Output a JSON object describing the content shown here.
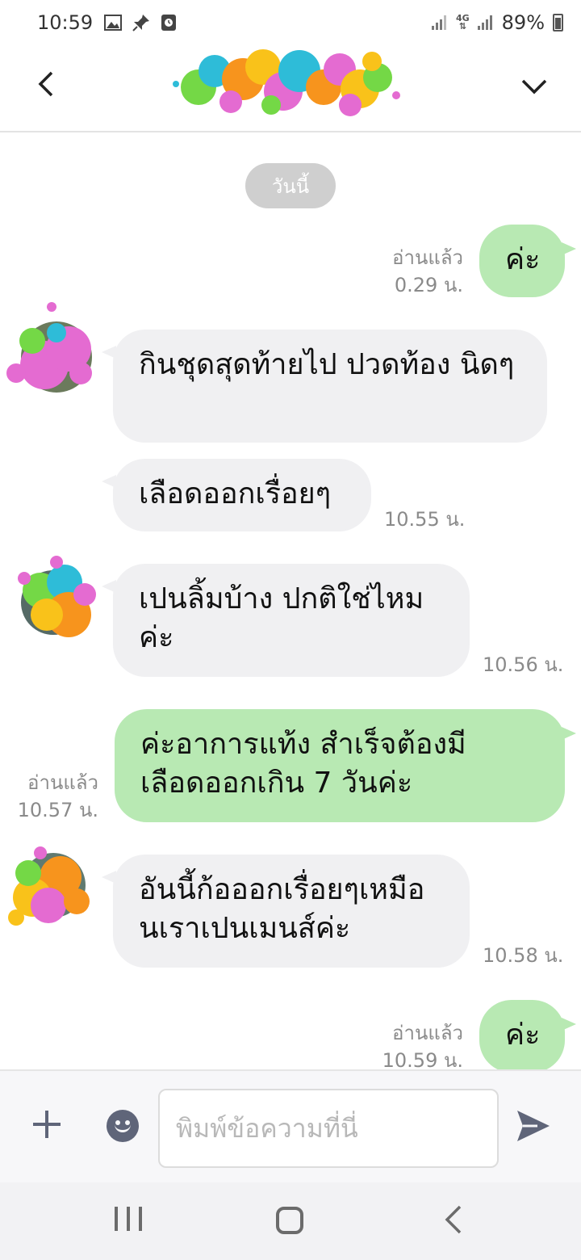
{
  "status_bar": {
    "time": "10:59",
    "icons": [
      "gallery-icon",
      "pin-icon",
      "clock-icon"
    ],
    "network": "4G",
    "battery": "89%"
  },
  "header": {
    "back_icon": "chevron-left-icon",
    "menu_icon": "chevron-down-icon"
  },
  "chat": {
    "date_label": "วันนี้",
    "messages": [
      {
        "dir": "out",
        "text": "ค่ะ",
        "read": "อ่านแล้ว",
        "time": "0.29 น."
      },
      {
        "dir": "in",
        "text": "กินชุดสุดท้ายไป ปวดท้อง นิดๆ",
        "time": ""
      },
      {
        "dir": "in",
        "text": "เลือดออกเรื่อยๆ",
        "time": "10.55 น."
      },
      {
        "dir": "in",
        "text": "เปนลิ้มบ้าง ปกติใช่ไหม ค่ะ",
        "time": "10.56 น."
      },
      {
        "dir": "out",
        "text": "ค่ะอาการแท้ง สำเร็จต้องมี เลือดออกเกิน 7 วันค่ะ",
        "read": "อ่านแล้ว",
        "time": "10.57 น."
      },
      {
        "dir": "in",
        "text": "อันนี้ก้อออกเรื่อยๆเหมือ นเราเปนเมนส์ค่ะ",
        "time": "10.58 น."
      },
      {
        "dir": "out",
        "text": "ค่ะ",
        "read": "อ่านแล้ว",
        "time": "10.59 น."
      }
    ]
  },
  "input": {
    "placeholder": "พิมพ์ข้อความที่นี่",
    "value": ""
  },
  "colors": {
    "outgoing_bubble": "#b8e9b3",
    "incoming_bubble": "#f0f0f2",
    "date_pill": "#cfcfcf"
  }
}
